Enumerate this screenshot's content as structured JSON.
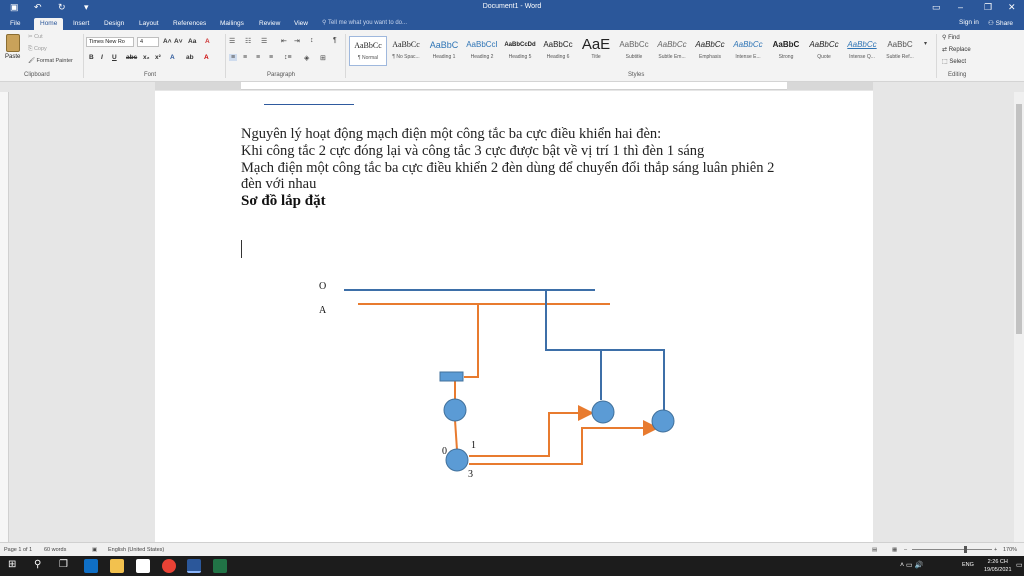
{
  "window": {
    "title": "Document1 - Word"
  },
  "tabs": [
    "File",
    "Home",
    "Insert",
    "Design",
    "Layout",
    "References",
    "Mailings",
    "Review",
    "View"
  ],
  "tell_me": "Tell me what you want to do...",
  "account": {
    "signin": "Sign in",
    "share": "Share"
  },
  "clipboard": {
    "paste": "Paste",
    "cut": "Cut",
    "copy": "Copy",
    "format_painter": "Format Painter",
    "label": "Clipboard"
  },
  "font": {
    "family": "Times New Ro",
    "size": "4",
    "label": "Font"
  },
  "paragraph": {
    "label": "Paragraph"
  },
  "styles": {
    "label": "Styles",
    "items": [
      {
        "sample": "AaBbCc",
        "name": "¶ Normal"
      },
      {
        "sample": "AaBbCc",
        "name": "¶ No Spac..."
      },
      {
        "sample": "AaBbC",
        "name": "Heading 1"
      },
      {
        "sample": "AaBbCcI",
        "name": "Heading 2"
      },
      {
        "sample": "AaBbCcDd",
        "name": "Heading 5"
      },
      {
        "sample": "AaBbCc",
        "name": "Heading 6"
      },
      {
        "sample": "AaE",
        "name": "Title"
      },
      {
        "sample": "AaBbCc",
        "name": "Subtitle"
      },
      {
        "sample": "AaBbCc",
        "name": "Subtle Em..."
      },
      {
        "sample": "AaBbCc",
        "name": "Emphasis"
      },
      {
        "sample": "AaBbCc",
        "name": "Intense E..."
      },
      {
        "sample": "AaBbC",
        "name": "Strong"
      },
      {
        "sample": "AaBbCc",
        "name": "Quote"
      },
      {
        "sample": "AaBbCc",
        "name": "Intense Q..."
      },
      {
        "sample": "AaBbC",
        "name": "Subtle Ref..."
      }
    ]
  },
  "editing": {
    "find": "Find",
    "replace": "Replace",
    "select": "Select",
    "label": "Editing"
  },
  "document": {
    "lines": [
      "Nguyên lý  hoạt động mạch điện một công tắc ba cực điều khiển hai đèn:",
      "Khi công tắc 2 cực đóng lại và công tắc 3 cực được bật về vị trí 1 thì đèn 1 sáng",
      "Mạch điện một công tắc ba cực điều khiển 2 đèn dùng để chuyển đổi thắp sáng luân phiên 2",
      "đèn với nhau"
    ],
    "heading": "Sơ đồ lắp đặt",
    "diagram_labels": {
      "neutral": "O",
      "phase": "A",
      "pos0": "0",
      "pos1": "1",
      "pos3": "3"
    },
    "colors": {
      "neutral_wire": "#3d6fa8",
      "phase_wire": "#e87b2f",
      "component_fill": "#5b9bd5",
      "component_stroke": "#41719c"
    }
  },
  "status": {
    "page": "Page 1 of 1",
    "words": "60 words",
    "language": "English (United States)",
    "zoom": "170%"
  },
  "taskbar": {
    "language": "ENG",
    "time": "2:26 CH",
    "date": "19/05/2021"
  }
}
